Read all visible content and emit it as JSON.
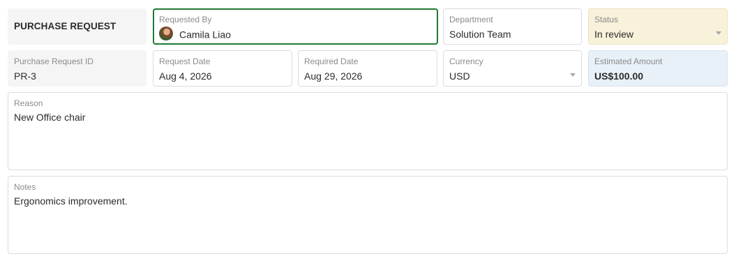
{
  "form": {
    "title": "PURCHASE REQUEST",
    "requested_by": {
      "label": "Requested By",
      "value": "Camila Liao",
      "avatar": "user-avatar"
    },
    "department": {
      "label": "Department",
      "value": "Solution Team"
    },
    "status": {
      "label": "Status",
      "value": "In review",
      "color": "#f8f2da"
    },
    "purchase_request_id": {
      "label": "Purchase Request ID",
      "value": "PR-3"
    },
    "request_date": {
      "label": "Request Date",
      "value": "Aug 4, 2026"
    },
    "required_date": {
      "label": "Required Date",
      "value": "Aug 29, 2026"
    },
    "currency": {
      "label": "Currency",
      "value": "USD"
    },
    "estimated_amount": {
      "label": "Estimated Amount",
      "value": "US$100.00",
      "color": "#e8f0f8"
    },
    "reason": {
      "label": "Reason",
      "value": "New Office chair"
    },
    "notes": {
      "label": "Notes",
      "value": "Ergonomics improvement."
    }
  },
  "colors": {
    "focus_border": "#1e7a34"
  }
}
